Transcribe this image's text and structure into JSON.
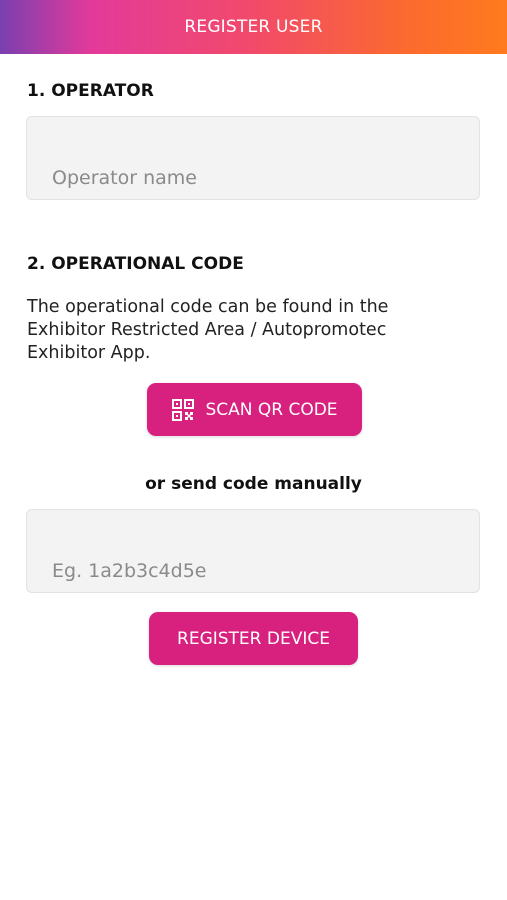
{
  "header": {
    "title": "REGISTER USER",
    "gradient_colors": [
      "#7a3fb0",
      "#e33a9a",
      "#f24a6a",
      "#fb6a2e",
      "#ff7a1e"
    ]
  },
  "operator_section": {
    "title": "1. OPERATOR",
    "input_placeholder": "Operator name",
    "input_value": ""
  },
  "code_section": {
    "title": "2. OPERATIONAL CODE",
    "description": "The operational code can be found in the Exhibitor Restricted Area / Autopromotec Exhibitor App.",
    "scan_button_label": "SCAN QR CODE",
    "scan_button_icon": "qr-code-icon",
    "manual_label": "or send code manually",
    "code_input_placeholder": "Eg. 1a2b3c4d5e",
    "code_input_value": ""
  },
  "register_button_label": "REGISTER DEVICE",
  "colors": {
    "accent": "#d8207e",
    "input_background": "#f3f3f3"
  }
}
